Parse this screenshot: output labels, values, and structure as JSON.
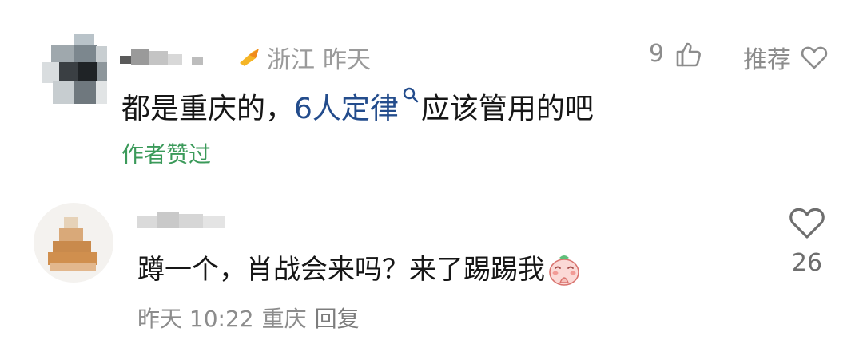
{
  "comments": [
    {
      "region": "浙江",
      "time": "昨天",
      "like_count": "9",
      "recommend_label": "推荐",
      "text_before": "都是重庆的，",
      "link_text": "6人定律",
      "text_after": "应该管用的吧",
      "author_liked": "作者赞过"
    },
    {
      "text": "蹲一个，肖战会来吗？来了踢踢我",
      "emoji_icon": "pray-emoji-icon",
      "time": "昨天 10:22",
      "region": "重庆",
      "reply_label": "回复",
      "like_count": "26"
    }
  ],
  "colors": {
    "link": "#234c8c",
    "author_liked": "#3b9a5a",
    "meta": "#9a9a9a"
  }
}
